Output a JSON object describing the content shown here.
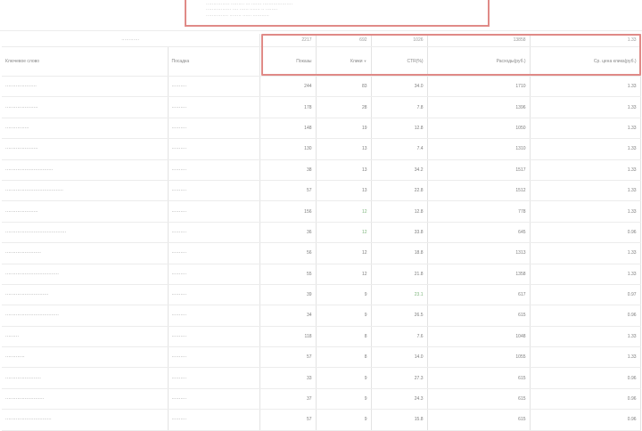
{
  "top_panel": {
    "line1": "················ ········· ··· ······· ····················",
    "line2": "················· ···· ······ ······· ·· ········",
    "line3": "··············· ········ ······ ···········"
  },
  "search": {
    "placeholder": "············"
  },
  "totals": [
    "2217",
    "692",
    "1026",
    "13858",
    "1.33"
  ],
  "headers": {
    "keyword": "Ключевое слово",
    "url": "Посадка",
    "metric1": "Показы",
    "metric2": "Клики",
    "metric3": "CTR(%)",
    "metric4": "Расходы(руб.)",
    "metric5": "Ср. цена клика(руб.)"
  },
  "rows": [
    {
      "kw": "·····················",
      "url": "··········",
      "m1": "244",
      "m2": "83",
      "m3": "34.0",
      "m4": "1710",
      "m5": "1.33"
    },
    {
      "kw": "······················",
      "url": "··········",
      "m1": "178",
      "m2": "28",
      "m3": "7.8",
      "m4": "1396",
      "m5": "1.33"
    },
    {
      "kw": "················",
      "url": "··········",
      "m1": "148",
      "m2": "19",
      "m3": "12.8",
      "m4": "1050",
      "m5": "1.33"
    },
    {
      "kw": "······················",
      "url": "··········",
      "m1": "130",
      "m2": "13",
      "m3": "7.4",
      "m4": "1310",
      "m5": "1.33"
    },
    {
      "kw": "································",
      "url": "··········",
      "m1": "38",
      "m2": "13",
      "m3": "34.2",
      "m4": "1517",
      "m5": "1.33"
    },
    {
      "kw": "·······································",
      "url": "··········",
      "m1": "57",
      "m2": "13",
      "m3": "22.8",
      "m4": "1512",
      "m5": "1.33"
    },
    {
      "kw": "······················",
      "url": "··········",
      "m1": "156",
      "m2": "12",
      "m3": "12.8",
      "m4": "778",
      "m5": "1.33",
      "green": true
    },
    {
      "kw": "·········································",
      "url": "··········",
      "m1": "36",
      "m2": "12",
      "m3": "33.8",
      "m4": "645",
      "m5": "0.96",
      "green": true
    },
    {
      "kw": "························",
      "url": "··········",
      "m1": "56",
      "m2": "12",
      "m3": "18.8",
      "m4": "1313",
      "m5": "1.33"
    },
    {
      "kw": "····································",
      "url": "··········",
      "m1": "55",
      "m2": "12",
      "m3": "21.8",
      "m4": "1358",
      "m5": "1.33"
    },
    {
      "kw": "·····························",
      "url": "··········",
      "m1": "39",
      "m2": "9",
      "m3": "23.1",
      "m4": "617",
      "m5": "0.97",
      "green3": true
    },
    {
      "kw": "····································",
      "url": "··········",
      "m1": "34",
      "m2": "9",
      "m3": "26.5",
      "m4": "615",
      "m5": "0.96"
    },
    {
      "kw": "·········",
      "url": "··········",
      "m1": "118",
      "m2": "8",
      "m3": "7.6",
      "m4": "1048",
      "m5": "1.33"
    },
    {
      "kw": "·············",
      "url": "··········",
      "m1": "57",
      "m2": "8",
      "m3": "14.0",
      "m4": "1055",
      "m5": "1.33"
    },
    {
      "kw": "························",
      "url": "··········",
      "m1": "33",
      "m2": "9",
      "m3": "27.3",
      "m4": "615",
      "m5": "0.96"
    },
    {
      "kw": "··························",
      "url": "··········",
      "m1": "37",
      "m2": "9",
      "m3": "24.3",
      "m4": "615",
      "m5": "0.96"
    },
    {
      "kw": "·······························",
      "url": "··········",
      "m1": "57",
      "m2": "9",
      "m3": "15.8",
      "m4": "615",
      "m5": "0.96"
    }
  ]
}
